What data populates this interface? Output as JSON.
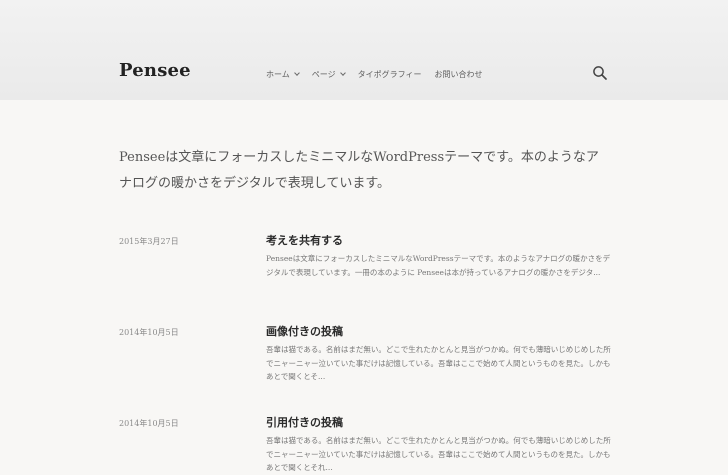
{
  "header": {
    "site_title": "Pensee",
    "nav": [
      {
        "label": "ホーム",
        "has_dropdown": true
      },
      {
        "label": "ページ",
        "has_dropdown": true
      },
      {
        "label": "タイポグラフィー",
        "has_dropdown": false
      },
      {
        "label": "お問い合わせ",
        "has_dropdown": false
      }
    ],
    "search_icon": "search-icon"
  },
  "intro": "Penseeは文章にフォーカスしたミニマルなWordPressテーマです。本のようなアナログの暖かさをデジタルで表現しています。",
  "posts": [
    {
      "date": "2015年3月27日",
      "title": "考えを共有する",
      "excerpt": "Penseeは文章にフォーカスしたミニマルなWordPressテーマです。本のようなアナログの暖かさをデジタルで表現しています。一冊の本のように Penseeは本が持っているアナログの暖かさをデジタ..."
    },
    {
      "date": "2014年10月5日",
      "title": "画像付きの投稿",
      "excerpt": "吾輩は猫である。名前はまだ無い。どこで生れたかとんと見当がつかぬ。何でも薄暗いじめじめした所でニャーニャー泣いていた事だけは記憶している。吾輩はここで始めて人間というものを見た。しかもあとで聞くとそ..."
    },
    {
      "date": "2014年10月5日",
      "title": "引用付きの投稿",
      "excerpt": "吾輩は猫である。名前はまだ無い。どこで生れたかとんと見当がつかぬ。何でも薄暗いじめじめした所でニャーニャー泣いていた事だけは記憶している。吾輩はここで始めて人間というものを見た。しかもあとで聞くとそれ..."
    }
  ]
}
